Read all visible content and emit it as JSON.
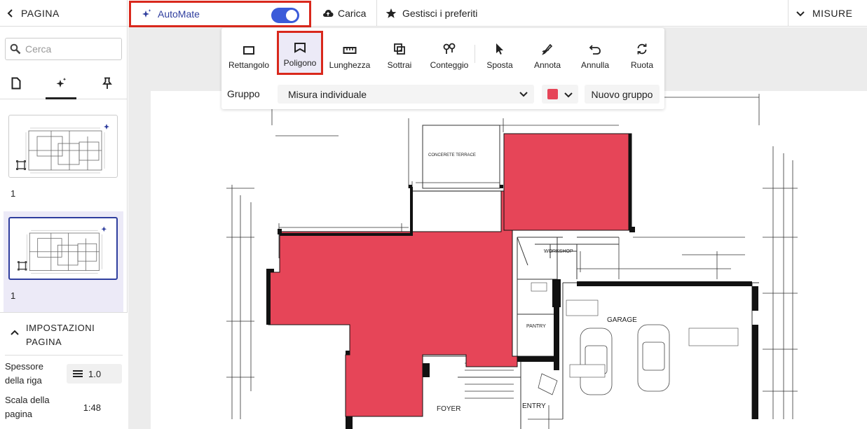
{
  "header": {
    "left_panel_label": "PAGINA",
    "automate_label": "AutoMate",
    "automate_enabled": true,
    "upload_label": "Carica",
    "favorites_label": "Gestisci i preferiti",
    "right_panel_label": "MISURE"
  },
  "sidebar": {
    "search_placeholder": "Cerca",
    "pages": [
      {
        "number": "1"
      },
      {
        "number": "1"
      }
    ],
    "settings": {
      "title": "IMPOSTAZIONI PAGINA",
      "line_thickness_label": "Spessore della riga",
      "line_thickness_value": "1.0",
      "page_scale_label": "Scala della pagina",
      "page_scale_value": "1:48"
    }
  },
  "toolbar": {
    "tools": [
      {
        "label": "Rettangolo",
        "icon": "rectangle-icon"
      },
      {
        "label": "Poligono",
        "icon": "polygon-icon",
        "selected": true
      },
      {
        "label": "Lunghezza",
        "icon": "ruler-icon"
      },
      {
        "label": "Sottrai",
        "icon": "subtract-icon"
      },
      {
        "label": "Conteggio",
        "icon": "count-icon"
      },
      {
        "label": "Sposta",
        "icon": "cursor-icon"
      },
      {
        "label": "Annota",
        "icon": "annotate-icon"
      },
      {
        "label": "Annulla",
        "icon": "undo-icon"
      },
      {
        "label": "Ruota",
        "icon": "rotate-icon"
      }
    ],
    "group_label": "Gruppo",
    "group_value": "Misura individuale",
    "group_color": "#e64558",
    "new_group_label": "Nuovo gruppo"
  },
  "plan": {
    "labels": {
      "terrace": "CONCERETE TERRACE",
      "workshop": "WORKSHOP",
      "garage": "GARAGE",
      "pantry": "PANTRY",
      "foyer": "FOYER",
      "entry": "ENTRY"
    },
    "fill_color": "#e64558"
  },
  "colors": {
    "accent": "#2f3e9e",
    "highlight": "#d9281c",
    "toggle": "#3b5bd9"
  }
}
